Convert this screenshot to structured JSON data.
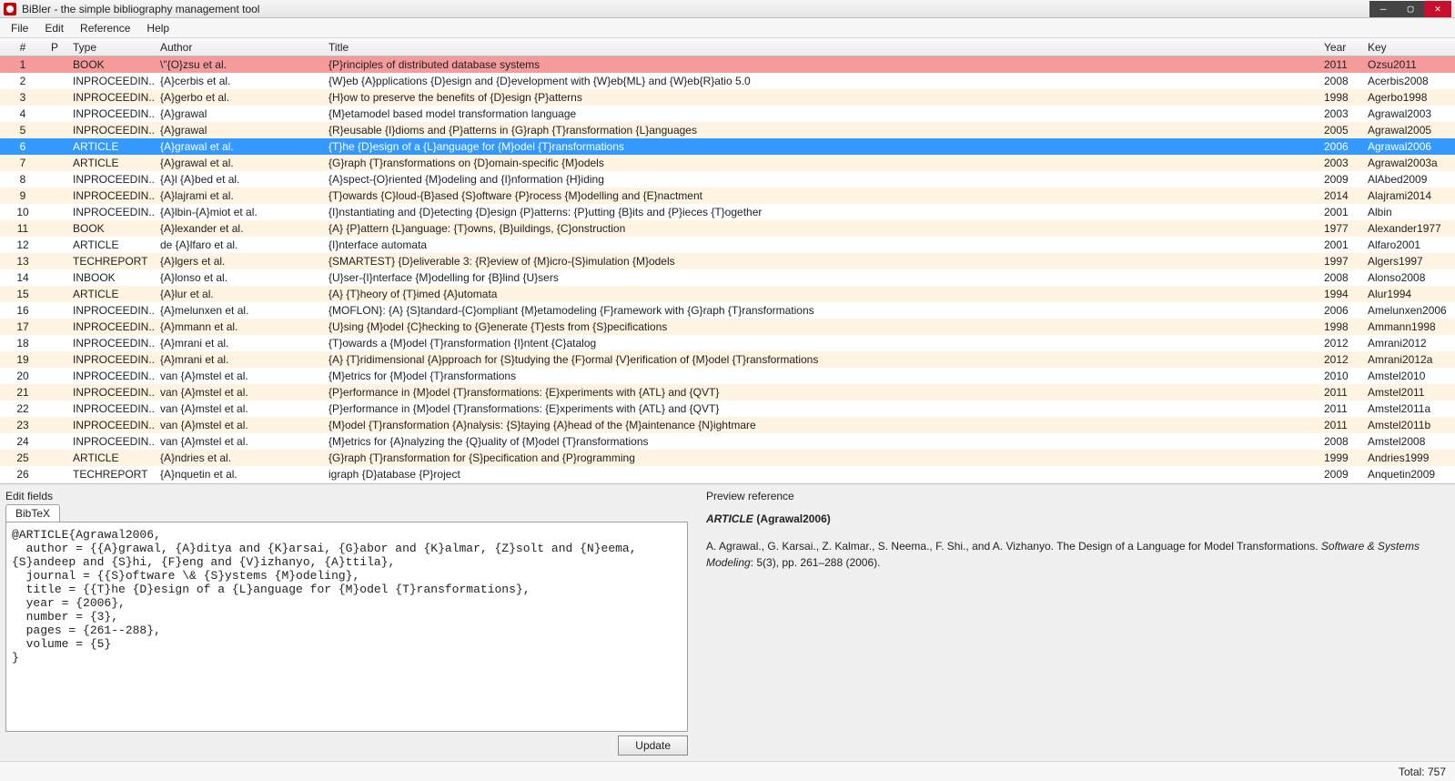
{
  "window": {
    "title": "BiBler - the simple bibliography management tool"
  },
  "menu": {
    "items": [
      "File",
      "Edit",
      "Reference",
      "Help"
    ]
  },
  "columns": {
    "num": "#",
    "p": "P",
    "type": "Type",
    "author": "Author",
    "title": "Title",
    "year": "Year",
    "key": "Key"
  },
  "rows": [
    {
      "n": "1",
      "type": "BOOK",
      "author": "\\\"{O}zsu et al.",
      "title": "{P}rinciples of distributed database systems",
      "year": "2011",
      "key": "Ozsu2011",
      "error": true
    },
    {
      "n": "2",
      "type": "INPROCEEDIN...",
      "author": "{A}cerbis et al.",
      "title": "{W}eb {A}pplications {D}esign and {D}evelopment with {W}eb{ML} and {W}eb{R}atio 5.0",
      "year": "2008",
      "key": "Acerbis2008"
    },
    {
      "n": "3",
      "type": "INPROCEEDIN...",
      "author": "{A}gerbo et al.",
      "title": "{H}ow to preserve the benefits of {D}esign {P}atterns",
      "year": "1998",
      "key": "Agerbo1998"
    },
    {
      "n": "4",
      "type": "INPROCEEDIN...",
      "author": "{A}grawal",
      "title": "{M}etamodel based model transformation language",
      "year": "2003",
      "key": "Agrawal2003"
    },
    {
      "n": "5",
      "type": "INPROCEEDIN...",
      "author": "{A}grawal",
      "title": "{R}eusable {I}dioms and {P}atterns in {G}raph {T}ransformation {L}anguages",
      "year": "2005",
      "key": "Agrawal2005"
    },
    {
      "n": "6",
      "type": "ARTICLE",
      "author": "{A}grawal et al.",
      "title": "{T}he {D}esign of a {L}anguage for {M}odel {T}ransformations",
      "year": "2006",
      "key": "Agrawal2006",
      "selected": true
    },
    {
      "n": "7",
      "type": "ARTICLE",
      "author": "{A}grawal et al.",
      "title": "{G}raph {T}ransformations on {D}omain-specific {M}odels",
      "year": "2003",
      "key": "Agrawal2003a"
    },
    {
      "n": "8",
      "type": "INPROCEEDIN...",
      "author": "{A}l {A}bed et al.",
      "title": "{A}spect-{O}riented {M}odeling and {I}nformation {H}iding",
      "year": "2009",
      "key": "AlAbed2009"
    },
    {
      "n": "9",
      "type": "INPROCEEDIN...",
      "author": "{A}lajrami et al.",
      "title": "{T}owards {C}loud-{B}ased {S}oftware {P}rocess {M}odelling and {E}nactment",
      "year": "2014",
      "key": "Alajrami2014"
    },
    {
      "n": "10",
      "type": "INPROCEEDIN...",
      "author": "{A}lbin-{A}miot et al.",
      "title": "{I}nstantiating and {D}etecting {D}esign {P}atterns: {P}utting {B}its and {P}ieces {T}ogether",
      "year": "2001",
      "key": "Albin"
    },
    {
      "n": "11",
      "type": "BOOK",
      "author": "{A}lexander et al.",
      "title": "{A} {P}attern {L}anguage: {T}owns, {B}uildings, {C}onstruction",
      "year": "1977",
      "key": "Alexander1977"
    },
    {
      "n": "12",
      "type": "ARTICLE",
      "author": "de {A}lfaro et al.",
      "title": "{I}nterface automata",
      "year": "2001",
      "key": "Alfaro2001"
    },
    {
      "n": "13",
      "type": "TECHREPORT",
      "author": "{A}lgers et al.",
      "title": "{SMARTEST} {D}eliverable 3: {R}eview of {M}icro-{S}imulation {M}odels",
      "year": "1997",
      "key": "Algers1997"
    },
    {
      "n": "14",
      "type": "INBOOK",
      "author": "{A}lonso et al.",
      "title": "{U}ser-{I}nterface {M}odelling for {B}lind {U}sers",
      "year": "2008",
      "key": "Alonso2008"
    },
    {
      "n": "15",
      "type": "ARTICLE",
      "author": "{A}lur et al.",
      "title": "{A} {T}heory of {T}imed {A}utomata",
      "year": "1994",
      "key": "Alur1994"
    },
    {
      "n": "16",
      "type": "INPROCEEDIN...",
      "author": "{A}melunxen et al.",
      "title": "{MOFLON}: {A} {S}tandard-{C}ompliant {M}etamodeling {F}ramework with {G}raph {T}ransformations",
      "year": "2006",
      "key": "Amelunxen2006"
    },
    {
      "n": "17",
      "type": "INPROCEEDIN...",
      "author": "{A}mmann et al.",
      "title": "{U}sing {M}odel {C}hecking to {G}enerate {T}ests from {S}pecifications",
      "year": "1998",
      "key": "Ammann1998"
    },
    {
      "n": "18",
      "type": "INPROCEEDIN...",
      "author": "{A}mrani et al.",
      "title": "{T}owards a {M}odel {T}ransformation {I}ntent {C}atalog",
      "year": "2012",
      "key": "Amrani2012"
    },
    {
      "n": "19",
      "type": "INPROCEEDIN...",
      "author": "{A}mrani et al.",
      "title": "{A} {T}ridimensional {A}pproach for {S}tudying the {F}ormal {V}erification of {M}odel {T}ransformations",
      "year": "2012",
      "key": "Amrani2012a"
    },
    {
      "n": "20",
      "type": "INPROCEEDIN...",
      "author": "van {A}mstel et al.",
      "title": "{M}etrics for {M}odel {T}ransformations",
      "year": "2010",
      "key": "Amstel2010"
    },
    {
      "n": "21",
      "type": "INPROCEEDIN...",
      "author": "van {A}mstel et al.",
      "title": "{P}erformance in {M}odel {T}ransformations: {E}xperiments with {ATL} and {QVT}",
      "year": "2011",
      "key": "Amstel2011"
    },
    {
      "n": "22",
      "type": "INPROCEEDIN...",
      "author": "van {A}mstel et al.",
      "title": "{P}erformance in {M}odel {T}ransformations: {E}xperiments with {ATL} and {QVT}",
      "year": "2011",
      "key": "Amstel2011a"
    },
    {
      "n": "23",
      "type": "INPROCEEDIN...",
      "author": "van {A}mstel et al.",
      "title": "{M}odel {T}ransformation {A}nalysis: {S}taying {A}head of the {M}aintenance {N}ightmare",
      "year": "2011",
      "key": "Amstel2011b"
    },
    {
      "n": "24",
      "type": "INPROCEEDIN...",
      "author": "van {A}mstel et al.",
      "title": "{M}etrics for {A}nalyzing the {Q}uality of {M}odel {T}ransformations",
      "year": "2008",
      "key": "Amstel2008"
    },
    {
      "n": "25",
      "type": "ARTICLE",
      "author": "{A}ndries et al.",
      "title": "{G}raph {T}ransformation for {S}pecification and {P}rogramming",
      "year": "1999",
      "key": "Andries1999"
    },
    {
      "n": "26",
      "type": "TECHREPORT",
      "author": "{A}nquetin et al.",
      "title": "igraph {D}atabase {P}roject",
      "year": "2009",
      "key": "Anquetin2009"
    }
  ],
  "edit": {
    "label": "Edit fields",
    "tab": "BibTeX",
    "bibtex": "@ARTICLE{Agrawal2006,\n  author = {{A}grawal, {A}ditya and {K}arsai, {G}abor and {K}almar, {Z}solt and {N}eema, {S}andeep and {S}hi, {F}eng and {V}izhanyo, {A}ttila},\n  journal = {{S}oftware \\& {S}ystems {M}odeling},\n  title = {{T}he {D}esign of a {L}anguage for {M}odel {T}ransformations},\n  year = {2006},\n  number = {3},\n  pages = {261--288},\n  volume = {5}\n}",
    "button": "Update"
  },
  "preview": {
    "label": "Preview reference",
    "type": "ARTICLE",
    "key": "(Agrawal2006)",
    "authors": "A. Agrawal., G. Karsai., Z. Kalmar., S. Neema., F. Shi., and A. Vizhanyo. The Design of a Language for Model Transformations. ",
    "journal": "Software & Systems Modeling",
    "tail": ": 5(3), pp. 261–288 (2006)."
  },
  "status": {
    "total": "Total: 757"
  }
}
